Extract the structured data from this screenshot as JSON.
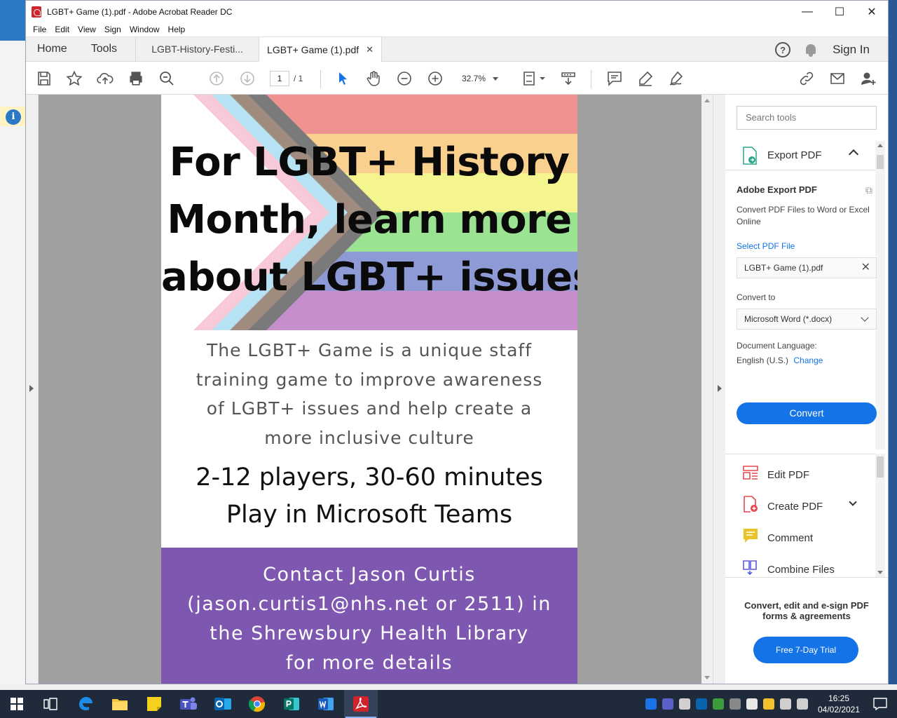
{
  "window": {
    "title": "LGBT+ Game (1).pdf - Adobe Acrobat Reader DC",
    "minimize_glyph": "—",
    "maximize_glyph": "☐",
    "close_glyph": "✕"
  },
  "menu": [
    "File",
    "Edit",
    "View",
    "Sign",
    "Window",
    "Help"
  ],
  "tabs": {
    "home": "Home",
    "tools": "Tools",
    "doc_tabs": [
      "LGBT-History-Festi...",
      "LGBT+ Game (1).pdf"
    ],
    "close_glyph": "✕",
    "sign_in": "Sign In",
    "help_glyph": "?"
  },
  "toolbar": {
    "page_current": "1",
    "page_total": "/ 1",
    "zoom": "32.7%"
  },
  "pdf": {
    "headline": [
      "For LGBT+ History",
      "Month, learn more",
      "about LGBT+ issues"
    ],
    "subtext": [
      "The LGBT+ Game is a unique staff",
      "training game to improve awareness",
      "of LGBT+ issues and help create a",
      "more inclusive culture"
    ],
    "players": [
      "2-12 players, 30-60 minutes",
      "Play in Microsoft Teams"
    ],
    "contact": [
      "Contact Jason Curtis",
      "(jason.curtis1@nhs.net or 2511) in",
      "the Shrewsbury Health Library",
      "for more details"
    ],
    "stripe_colors": [
      "#ee938f",
      "#f9d08e",
      "#f4f58e",
      "#9be393",
      "#8e9ad6",
      "#c68fcc"
    ],
    "chevron_colors": [
      "#ffffff",
      "#f8c9d8",
      "#b6e2f3",
      "#a08c7e",
      "#7a7a7a"
    ]
  },
  "tools_pane": {
    "search_placeholder": "Search tools",
    "export_label": "Export PDF",
    "export_title": "Adobe Export PDF",
    "export_desc": "Convert PDF Files to Word or Excel Online",
    "select_file_label": "Select PDF File",
    "selected_file": "LGBT+ Game (1).pdf",
    "clear_glyph": "✕",
    "convert_to_label": "Convert to",
    "convert_to_value": "Microsoft Word (*.docx)",
    "doc_language_label": "Document Language:",
    "doc_language_value": "English (U.S.)",
    "change_link": "Change",
    "convert_button": "Convert",
    "tools": [
      {
        "label": "Edit PDF",
        "icon": "edit-pdf-icon",
        "color": "#e34850"
      },
      {
        "label": "Create PDF",
        "icon": "create-pdf-icon",
        "color": "#e34850"
      },
      {
        "label": "Comment",
        "icon": "comment-icon",
        "color": "#e8c42a"
      },
      {
        "label": "Combine Files",
        "icon": "combine-files-icon",
        "color": "#5c5ce0"
      }
    ],
    "promo_text": "Convert, edit and e-sign PDF forms & agreements",
    "trial_button": "Free 7-Day Trial"
  },
  "taskbar": {
    "time": "16:25",
    "date": "04/02/2021",
    "apps": [
      "start",
      "task-view",
      "edge",
      "file-explorer",
      "sticky-notes",
      "teams",
      "outlook",
      "chrome",
      "publisher",
      "word",
      "acrobat"
    ]
  },
  "colors": {
    "accent": "#1473e6",
    "contact_bg": "#7e57b0",
    "taskbar_bg": "#1f2a3a"
  }
}
